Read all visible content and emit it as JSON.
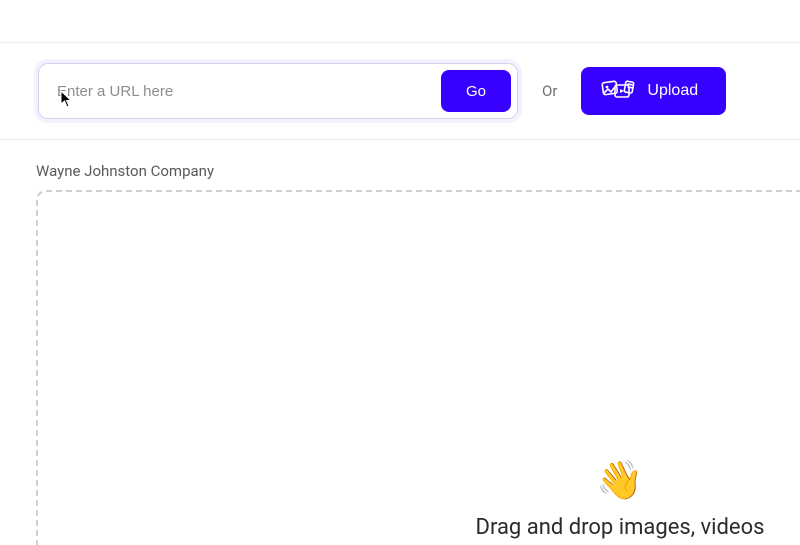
{
  "url_bar": {
    "input_placeholder": "Enter a URL here",
    "input_value": "",
    "go_label": "Go",
    "or_label": "Or",
    "upload_label": "Upload"
  },
  "company_name": "Wayne Johnston Company",
  "dropzone": {
    "wave_emoji": "👋",
    "text": "Drag and drop images, videos"
  },
  "icons": {
    "upload_icon": "media-upload-icon",
    "cursor_icon": "mouse-pointer-icon"
  },
  "colors": {
    "primary": "#3700ff",
    "border": "#d5d3e8",
    "divider": "#eeeeee",
    "dash": "#cfcfcf",
    "muted_text": "#6e6e6e"
  }
}
